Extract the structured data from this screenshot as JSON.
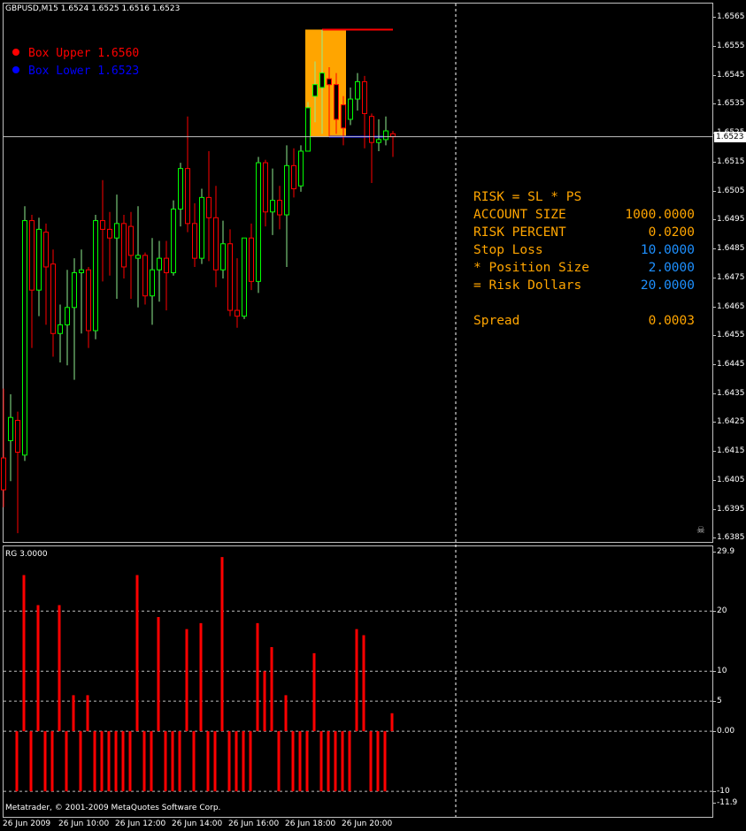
{
  "chart_title": "GBPUSD,M15  1.6524 1.6525 1.6516 1.6523",
  "indicator_title": "RG 3.0000",
  "copyright": "Metatrader, © 2001-2009 MetaQuotes Software Corp.",
  "legend": [
    {
      "label": "Box Upper 1.6560",
      "color": "#ff0000"
    },
    {
      "label": "Box Lower 1.6523",
      "color": "#0000ff"
    }
  ],
  "panel": {
    "rows": [
      {
        "label": "RISK = SL * PS",
        "value": "",
        "label_color": "#ffa500",
        "value_color": "#ffa500"
      },
      {
        "label": "ACCOUNT SIZE",
        "value": "1000.0000",
        "label_color": "#ffa500",
        "value_color": "#ffa500"
      },
      {
        "label": "RISK PERCENT",
        "value": "0.0200",
        "label_color": "#ffa500",
        "value_color": "#ffa500"
      },
      {
        "label": "Stop Loss",
        "value": "10.0000",
        "label_color": "#ffa500",
        "value_color": "#1e90ff"
      },
      {
        "label": "* Position Size",
        "value": "2.0000",
        "label_color": "#ffa500",
        "value_color": "#1e90ff"
      },
      {
        "label": "= Risk Dollars",
        "value": "20.0000",
        "label_color": "#ffa500",
        "value_color": "#1e90ff"
      },
      {
        "label": "",
        "value": "",
        "label_color": "#ffa500",
        "value_color": "#ffa500"
      },
      {
        "label": "Spread",
        "value": "0.0003",
        "label_color": "#ffa500",
        "value_color": "#ffa500"
      }
    ]
  },
  "current_price_label": "1.6523",
  "colors": {
    "bull_candle": "#00ff00",
    "bear_candle": "#ff0000",
    "bull_line": "#90ee90",
    "bear_line": "#ff0000",
    "box_fill": "#ffa500",
    "box_upper": "#ff0000",
    "box_lower": "#0000ff",
    "histogram": "#ff0000",
    "grid": "#c0c0c0"
  },
  "chart_data": [
    {
      "type": "candlestick",
      "title": "GBPUSD,M15",
      "ylim": [
        1.6383,
        1.6569
      ],
      "y_ticks": [
        "1.6565",
        "1.6555",
        "1.6545",
        "1.6535",
        "1.6525",
        "1.6515",
        "1.6505",
        "1.6495",
        "1.6485",
        "1.6475",
        "1.6465",
        "1.6455",
        "1.6445",
        "1.6435",
        "1.6425",
        "1.6415",
        "1.6405",
        "1.6395",
        "1.6385"
      ],
      "candles": [
        {
          "o": 1.6412,
          "h": 1.6436,
          "c": 1.6401,
          "l": 1.6395
        },
        {
          "o": 1.6418,
          "h": 1.6434,
          "c": 1.6426,
          "l": 1.6404
        },
        {
          "o": 1.6425,
          "h": 1.6428,
          "c": 1.6414,
          "l": 1.6386
        },
        {
          "o": 1.6413,
          "h": 1.6499,
          "c": 1.6494,
          "l": 1.6411
        },
        {
          "o": 1.6494,
          "h": 1.6496,
          "c": 1.647,
          "l": 1.645
        },
        {
          "o": 1.647,
          "h": 1.6495,
          "c": 1.6491,
          "l": 1.6461
        },
        {
          "o": 1.649,
          "h": 1.6493,
          "c": 1.6478,
          "l": 1.6458
        },
        {
          "o": 1.6479,
          "h": 1.6484,
          "c": 1.6455,
          "l": 1.6447
        },
        {
          "o": 1.6455,
          "h": 1.6465,
          "c": 1.6458,
          "l": 1.6445
        },
        {
          "o": 1.6458,
          "h": 1.6477,
          "c": 1.6464,
          "l": 1.6444
        },
        {
          "o": 1.6464,
          "h": 1.6481,
          "c": 1.6476,
          "l": 1.6439
        },
        {
          "o": 1.6476,
          "h": 1.6484,
          "c": 1.6477,
          "l": 1.6455
        },
        {
          "o": 1.6477,
          "h": 1.6478,
          "c": 1.6456,
          "l": 1.645
        },
        {
          "o": 1.6456,
          "h": 1.6496,
          "c": 1.6494,
          "l": 1.6453
        },
        {
          "o": 1.6494,
          "h": 1.6508,
          "c": 1.6491,
          "l": 1.6473
        },
        {
          "o": 1.6491,
          "h": 1.6497,
          "c": 1.6488,
          "l": 1.6475
        },
        {
          "o": 1.6488,
          "h": 1.6503,
          "c": 1.6493,
          "l": 1.6467
        },
        {
          "o": 1.6493,
          "h": 1.6496,
          "c": 1.6478,
          "l": 1.6474
        },
        {
          "o": 1.6492,
          "h": 1.6497,
          "c": 1.6482,
          "l": 1.6467
        },
        {
          "o": 1.6481,
          "h": 1.6499,
          "c": 1.6482,
          "l": 1.6464
        },
        {
          "o": 1.6482,
          "h": 1.6483,
          "c": 1.6468,
          "l": 1.6465
        },
        {
          "o": 1.6468,
          "h": 1.6488,
          "c": 1.6477,
          "l": 1.6458
        },
        {
          "o": 1.6477,
          "h": 1.6487,
          "c": 1.6481,
          "l": 1.6466
        },
        {
          "o": 1.6481,
          "h": 1.6487,
          "c": 1.6476,
          "l": 1.6463
        },
        {
          "o": 1.6476,
          "h": 1.6501,
          "c": 1.6498,
          "l": 1.6475
        },
        {
          "o": 1.6498,
          "h": 1.6514,
          "c": 1.6512,
          "l": 1.6492
        },
        {
          "o": 1.6512,
          "h": 1.653,
          "c": 1.6493,
          "l": 1.649
        },
        {
          "o": 1.6493,
          "h": 1.65,
          "c": 1.6481,
          "l": 1.6478
        },
        {
          "o": 1.6481,
          "h": 1.6505,
          "c": 1.6502,
          "l": 1.6479
        },
        {
          "o": 1.6502,
          "h": 1.6518,
          "c": 1.6495,
          "l": 1.648
        },
        {
          "o": 1.6495,
          "h": 1.6506,
          "c": 1.6477,
          "l": 1.6471
        },
        {
          "o": 1.6477,
          "h": 1.6494,
          "c": 1.6486,
          "l": 1.6474
        },
        {
          "o": 1.6486,
          "h": 1.6491,
          "c": 1.6463,
          "l": 1.6461
        },
        {
          "o": 1.6463,
          "h": 1.6481,
          "c": 1.6461,
          "l": 1.6457
        },
        {
          "o": 1.6461,
          "h": 1.6488,
          "c": 1.6488,
          "l": 1.646
        },
        {
          "o": 1.6488,
          "h": 1.6493,
          "c": 1.6473,
          "l": 1.647
        },
        {
          "o": 1.6473,
          "h": 1.6516,
          "c": 1.6514,
          "l": 1.6469
        },
        {
          "o": 1.6514,
          "h": 1.6515,
          "c": 1.6497,
          "l": 1.6492
        },
        {
          "o": 1.6497,
          "h": 1.6512,
          "c": 1.6501,
          "l": 1.6489
        },
        {
          "o": 1.6501,
          "h": 1.6506,
          "c": 1.6496,
          "l": 1.6491
        },
        {
          "o": 1.6496,
          "h": 1.652,
          "c": 1.6513,
          "l": 1.6478
        },
        {
          "o": 1.6513,
          "h": 1.6519,
          "c": 1.6505,
          "l": 1.6502
        },
        {
          "o": 1.6506,
          "h": 1.652,
          "c": 1.6518,
          "l": 1.6504
        },
        {
          "o": 1.6518,
          "h": 1.6535,
          "c": 1.6533,
          "l": 1.6522
        },
        {
          "o": 1.6537,
          "h": 1.6549,
          "c": 1.6541,
          "l": 1.6528
        },
        {
          "o": 1.654,
          "h": 1.656,
          "c": 1.6545,
          "l": 1.6524
        },
        {
          "o": 1.6543,
          "h": 1.6547,
          "c": 1.6541,
          "l": 1.6523
        },
        {
          "o": 1.6541,
          "h": 1.6545,
          "c": 1.6529,
          "l": 1.6524
        },
        {
          "o": 1.6534,
          "h": 1.6537,
          "c": 1.6526,
          "l": 1.652
        },
        {
          "o": 1.6529,
          "h": 1.654,
          "c": 1.6536,
          "l": 1.6527
        },
        {
          "o": 1.6536,
          "h": 1.6545,
          "c": 1.6542,
          "l": 1.6532
        },
        {
          "o": 1.6542,
          "h": 1.6544,
          "c": 1.6531,
          "l": 1.6519
        },
        {
          "o": 1.653,
          "h": 1.6531,
          "c": 1.6521,
          "l": 1.6507
        },
        {
          "o": 1.6521,
          "h": 1.6529,
          "c": 1.6522,
          "l": 1.6518
        },
        {
          "o": 1.6522,
          "h": 1.653,
          "c": 1.6525,
          "l": 1.652
        },
        {
          "o": 1.6524,
          "h": 1.6525,
          "c": 1.6523,
          "l": 1.6516
        }
      ],
      "box": {
        "upper": 1.656,
        "lower": 1.6523,
        "from_index": 43,
        "to_index": 48
      },
      "x_ticks": [
        "26 Jun 2009",
        "26 Jun 10:00",
        "26 Jun 12:00",
        "26 Jun 14:00",
        "26 Jun 16:00",
        "26 Jun 18:00",
        "26 Jun 20:00"
      ]
    },
    {
      "type": "bar",
      "title": "RG 3.0000",
      "ylim": [
        -11.9,
        29.9
      ],
      "y_ticks": [
        "29.9",
        "20",
        "10",
        "5",
        "0.00",
        "-10",
        "-11.9"
      ],
      "values": [
        -10,
        26,
        -10,
        21,
        -10,
        -10,
        21,
        -10,
        6,
        -10,
        6,
        -10,
        -10,
        -10,
        -10,
        -10,
        -10,
        26,
        -10,
        -10,
        19,
        -10,
        -10,
        -10,
        17,
        -10,
        18,
        -10,
        -10,
        29,
        -10,
        -10,
        -10,
        -10,
        18,
        10,
        14,
        -10,
        6,
        -10,
        -10,
        -10,
        13,
        -10,
        -10,
        -10,
        -10,
        -10,
        17,
        16,
        -10,
        -10,
        -10,
        3
      ]
    }
  ]
}
